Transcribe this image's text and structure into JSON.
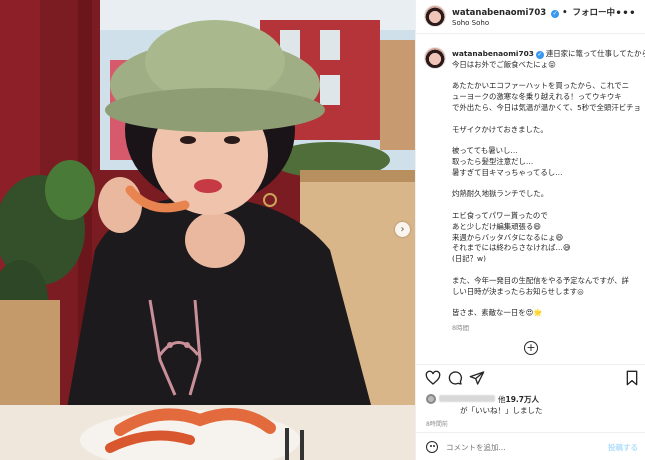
{
  "header": {
    "username": "watanabenaomi703",
    "verified_mark": "✓",
    "separator": "•",
    "follow_status": "フォロー中",
    "location": "Soho Soho",
    "more_icon": "more-horizontal-icon"
  },
  "caption": {
    "username": "watanabenaomi703",
    "verified_mark": "✓",
    "lines": [
      "連日家に篭って仕事してたから",
      "今日はお外でご飯食べたにょ😝",
      "",
      "あたたかいエコファーハットを買ったから、これでニ",
      "ューヨークの激寒な冬乗り越えれる！ってウキウキ",
      "で外出たら、今日は気温が温かくて、5秒で全頭汗ビチョ",
      "",
      "モザイクかけておきました。",
      "",
      "被ってても暑いし…",
      "取ったら髪型注意だし…",
      "暑すぎて目キマっちゃってるし…",
      "",
      "灼熱耐久地獄ランチでした。",
      "",
      "エビ食ってパワー貰ったので",
      "あと少しだけ編集頑張る😄",
      "来週からバッタバタになるにょ😄",
      "それまでには終わらさなければ…😅",
      "(日記？w)",
      "",
      "また、今年一発目の生配信をやる予定なんですが、詳",
      "しい日時が決まったらお知らせします◎",
      "",
      "皆さま、素敵な一日を😍🌟"
    ],
    "time": "8時間"
  },
  "actions": {
    "like_icon": "heart-icon",
    "comment_icon": "comment-icon",
    "share_icon": "share-icon",
    "save_icon": "bookmark-icon"
  },
  "likes": {
    "prefix": "他",
    "count": "19.7万人",
    "suffix": "が「いいね！」しました"
  },
  "post_time": "8時間前",
  "comment": {
    "placeholder": "コメントを追加...",
    "post_label": "投稿する",
    "emoji_icon": "emoji-icon"
  },
  "photo": {
    "next_icon": "chevron-right-icon",
    "colors": {
      "wall": "#7a1c22",
      "hat": "#9fae84",
      "sweater": "#1c1a1c",
      "window": "#cfe0ea"
    }
  }
}
